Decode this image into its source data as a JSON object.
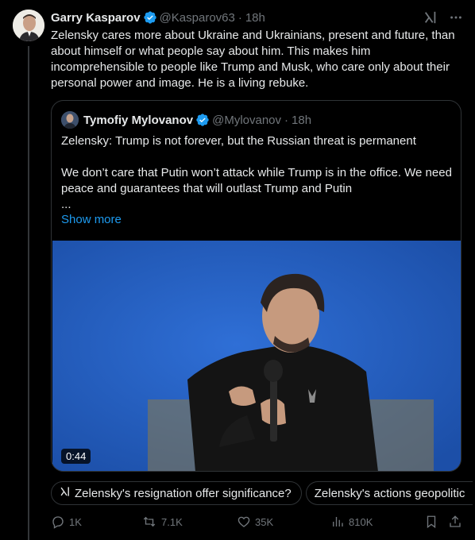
{
  "tweet": {
    "author": "Garry Kasparov",
    "handle": "@Kasparov63",
    "separator": "·",
    "time": "18h",
    "text": "Zelensky cares more about Ukraine and Ukrainians, present and future, than about himself or what people say about him. This makes him incomprehensible to people like Trump and Musk, who care only about their personal power and image. He is a living rebuke."
  },
  "quote": {
    "author": "Tymofiy Mylovanov",
    "handle": "@Mylovanov",
    "separator": "·",
    "time": "18h",
    "line1": "Zelensky: Trump is not forever, but the Russian threat is permanent",
    "line2": "We don’t care that Putin won’t attack while Trump is in the office. We need peace and guarantees that will outlast Trump and Putin",
    "line3": "...",
    "show_more": "Show more",
    "video_duration": "0:44"
  },
  "chips": [
    {
      "label": "Zelensky's resignation offer significance?"
    },
    {
      "label": "Zelensky's actions geopolitic"
    }
  ],
  "actions": {
    "replies": "1K",
    "reposts": "7.1K",
    "likes": "35K",
    "views": "810K"
  },
  "icons": {
    "verified": "verified-badge-icon",
    "grok": "grok-icon",
    "more": "more-icon",
    "reply": "reply-icon",
    "repost": "repost-icon",
    "like": "like-icon",
    "views": "views-icon",
    "bookmark": "bookmark-icon",
    "share": "share-icon"
  },
  "colors": {
    "background": "#000000",
    "text": "#e7e9ea",
    "secondary": "#71767b",
    "accent": "#1d9bf0",
    "border": "#2f3336"
  }
}
